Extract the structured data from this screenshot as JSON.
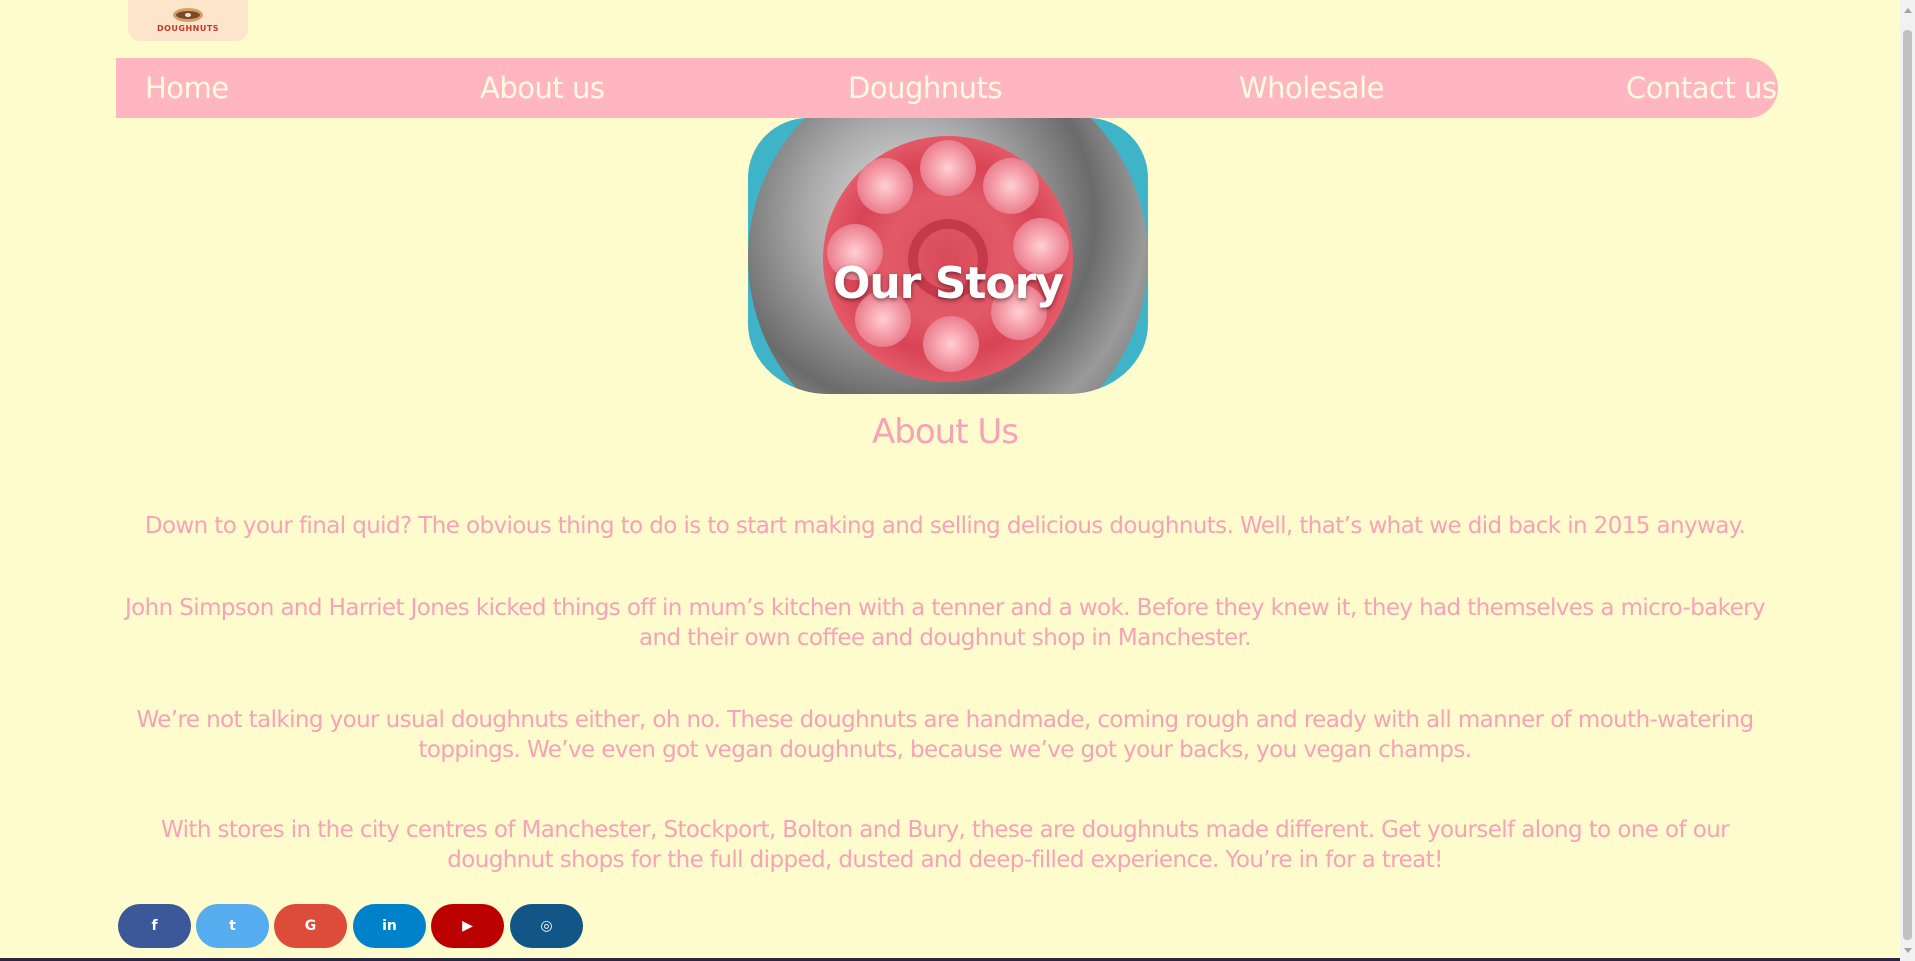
{
  "logo": {
    "text": "DOUGHNUTS"
  },
  "nav": {
    "items": [
      {
        "label": "Home"
      },
      {
        "label": "About us"
      },
      {
        "label": "Doughnuts"
      },
      {
        "label": "Wholesale"
      },
      {
        "label": "Contact us"
      }
    ]
  },
  "hero": {
    "title": "Our Story"
  },
  "about": {
    "heading": "About Us",
    "paragraphs": [
      "Down to your final quid? The obvious thing to do is to start making and selling delicious doughnuts. Well, that’s what we did back in 2015 anyway.",
      "John Simpson and Harriet Jones kicked things off in mum’s kitchen with a tenner and a wok. Before they knew it, they had themselves a micro-bakery and their own coffee and doughnut shop in Manchester.",
      "We’re not talking your usual doughnuts either, oh no. These doughnuts are handmade, coming rough and ready with all manner of mouth-watering toppings. We’ve even got vegan doughnuts, because we’ve got your backs, you vegan champs.",
      "With stores in the city centres of Manchester, Stockport, Bolton and Bury, these are doughnuts made different. Get yourself along to one of our doughnut shops for the full dipped, dusted and deep-filled experience. You’re in for a treat!"
    ]
  },
  "social": [
    {
      "icon": "facebook-icon",
      "glyph": "f",
      "color": "#3b5998"
    },
    {
      "icon": "twitter-icon",
      "glyph": "t",
      "color": "#55acee"
    },
    {
      "icon": "google-icon",
      "glyph": "G",
      "color": "#dd4b39"
    },
    {
      "icon": "linkedin-icon",
      "glyph": "in",
      "color": "#0082ca"
    },
    {
      "icon": "youtube-icon",
      "glyph": "▶",
      "color": "#bb0000"
    },
    {
      "icon": "instagram-icon",
      "glyph": "◎",
      "color": "#125688"
    }
  ],
  "colors": {
    "background": "#fefbcc",
    "nav": "#ffb6c1",
    "nav_text": "#fffbe0",
    "text": "#f5a3b8"
  }
}
